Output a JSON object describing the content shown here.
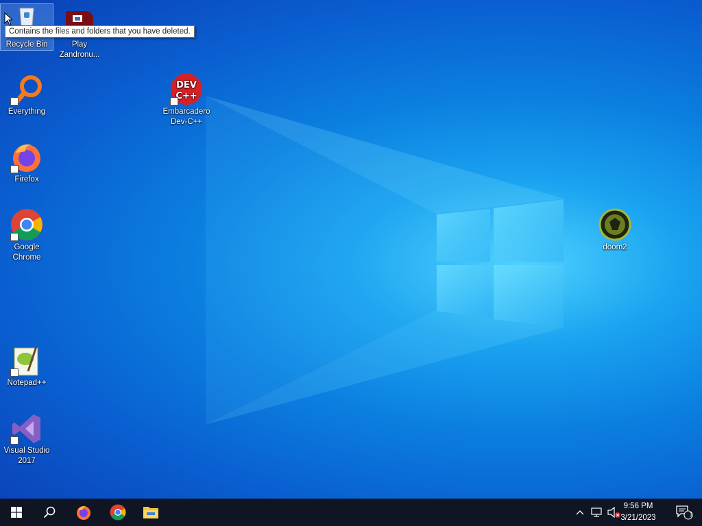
{
  "desktop": {
    "icons": {
      "recycle_bin": "Recycle Bin",
      "zandronum": "Play Zandronu...",
      "everything": "Everything",
      "devcpp": "Embarcadero Dev-C++",
      "firefox": "Firefox",
      "chrome": "Google Chrome",
      "doom2": "doom2",
      "notepadpp": "Notepad++",
      "vs2017": "Visual Studio 2017"
    },
    "devcpp_logo_text": "DEV C++",
    "tooltip": "Contains the files and folders that you have deleted."
  },
  "taskbar": {
    "time": "9:56 PM",
    "date": "3/21/2023",
    "notification_count": "1"
  },
  "colors": {
    "taskbar": "#0f1523",
    "desktop_accent": "#1aa3f0"
  }
}
